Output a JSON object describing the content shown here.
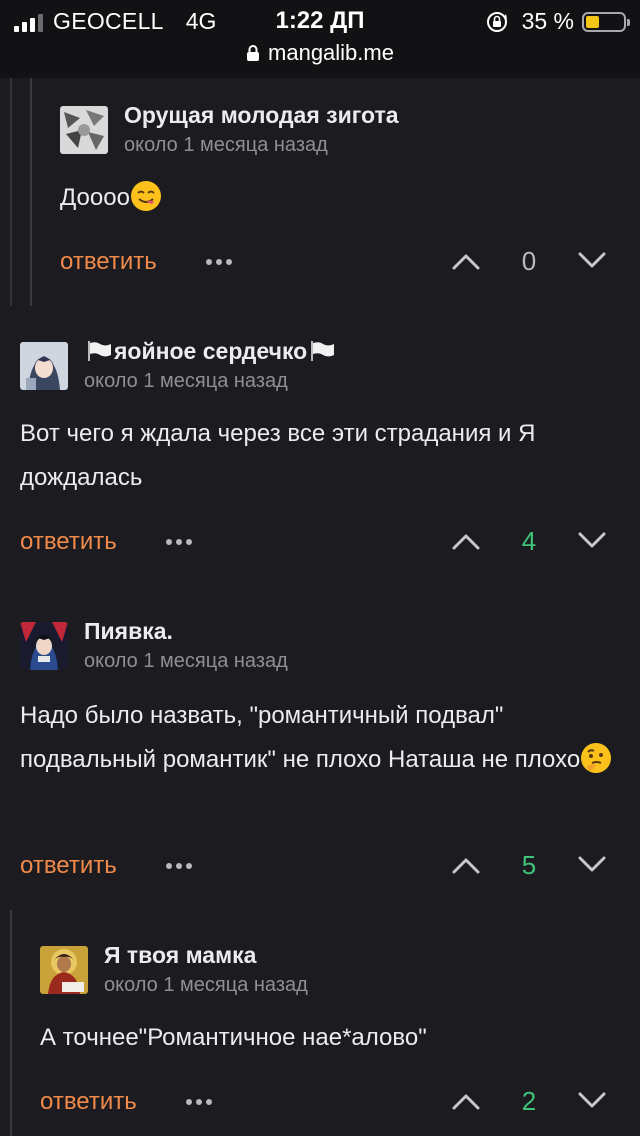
{
  "status_bar": {
    "carrier": "GEOCELL",
    "network": "4G",
    "time": "1:22 ДП",
    "battery_text": "35 %",
    "battery_level": 0.35
  },
  "browser": {
    "url": "mangalib.me"
  },
  "colors": {
    "reply": "#f08a4b",
    "score_positive": "#3fc27a",
    "score_zero": "#b9b9be"
  },
  "comments": [
    {
      "username": "Орущая молодая зигота",
      "time": "около 1 месяца назад",
      "text": "Доооо",
      "emoji": "yum-face-emoji",
      "reply_label": "ответить",
      "score": "0"
    },
    {
      "username": "яойное сердечко",
      "time": "около 1 месяца назад",
      "text": "Вот чего я ждала через все эти страдания и Я дождалась",
      "reply_label": "ответить",
      "score": "4"
    },
    {
      "username": "Пиявка.",
      "time": "около 1 месяца назад",
      "text": "Надо было назвать, \"романтичный подвал\" подвальный романтик\" не плохо Наташа не плохо",
      "emoji": "thinking-face-emoji",
      "reply_label": "ответить",
      "score": "5"
    },
    {
      "username": "Я твоя мамка",
      "time": "около 1 месяца назад",
      "text": "А точнее\"Романтичное нае*алово\"",
      "reply_label": "ответить",
      "score": "2"
    }
  ]
}
